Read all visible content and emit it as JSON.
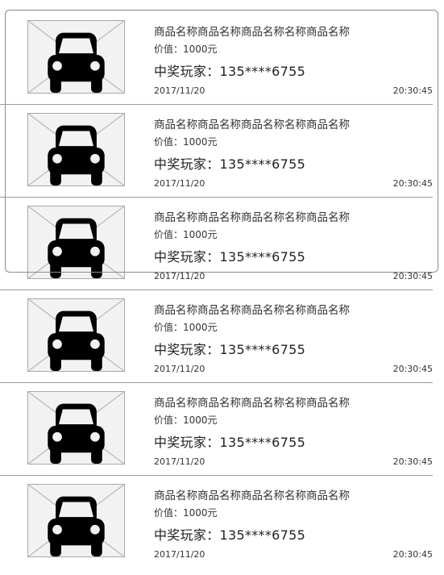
{
  "items": [
    {
      "title": "商品名称商品名称商品名称名称商品名称",
      "value": "价值：1000元",
      "winner": "中奖玩家：135****6755",
      "date": "2017/11/20",
      "time": "20:30:45",
      "image_icon": "car-icon"
    },
    {
      "title": "商品名称商品名称商品名称名称商品名称",
      "value": "价值：1000元",
      "winner": "中奖玩家：135****6755",
      "date": "2017/11/20",
      "time": "20:30:45",
      "image_icon": "car-icon"
    },
    {
      "title": "商品名称商品名称商品名称名称商品名称",
      "value": "价值：1000元",
      "winner": "中奖玩家：135****6755",
      "date": "2017/11/20",
      "time": "20:30:45",
      "image_icon": "car-icon"
    },
    {
      "title": "商品名称商品名称商品名称名称商品名称",
      "value": "价值：1000元",
      "winner": "中奖玩家：135****6755",
      "date": "2017/11/20",
      "time": "20:30:45",
      "image_icon": "car-icon"
    },
    {
      "title": "商品名称商品名称商品名称名称商品名称",
      "value": "价值：1000元",
      "winner": "中奖玩家：135****6755",
      "date": "2017/11/20",
      "time": "20:30:45",
      "image_icon": "car-icon"
    },
    {
      "title": "商品名称商品名称商品名称名称商品名称",
      "value": "价值：1000元",
      "winner": "中奖玩家：135****6755",
      "date": "2017/11/20",
      "time": "20:30:45",
      "image_icon": "car-icon"
    }
  ]
}
